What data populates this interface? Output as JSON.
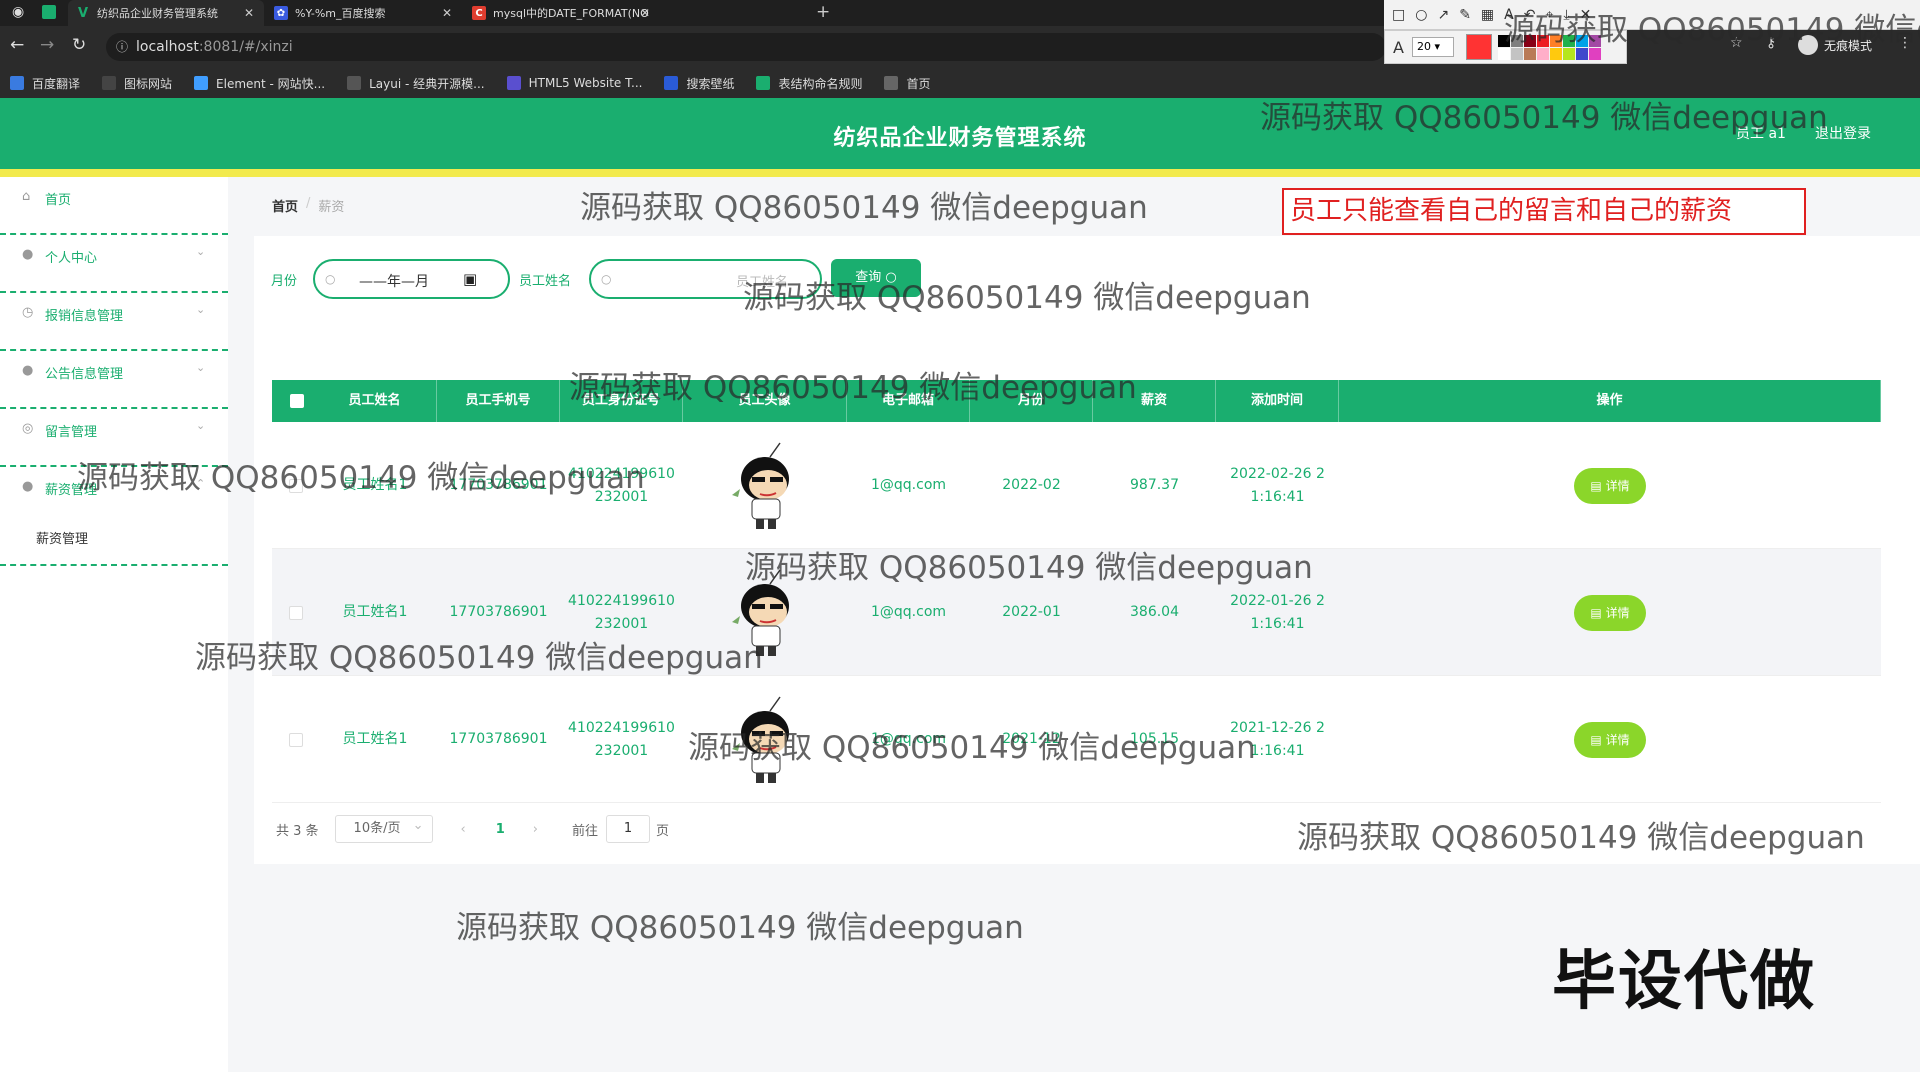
{
  "browser": {
    "tabs": [
      {
        "title": "纺织品企业财务管理系统",
        "icon_text": "V",
        "icon_color": "#1aae6f"
      },
      {
        "title": "%Y-%m_百度搜索",
        "icon_text": "✿",
        "icon_color": "#3a5be0"
      },
      {
        "title": "mysql中的DATE_FORMAT(NO",
        "icon_text": "C",
        "icon_color": "#e03d2f"
      }
    ],
    "url_host": "localhost",
    "url_rest": ":8081/#/xinzi",
    "incognito_label": "无痕模式",
    "bookmarks": [
      {
        "label": "百度翻译",
        "icon_color": "#3a7be0"
      },
      {
        "label": "图标网站",
        "icon_color": "#444"
      },
      {
        "label": "Element - 网站快...",
        "icon_color": "#409eff"
      },
      {
        "label": "Layui - 经典开源模...",
        "icon_color": "#555"
      },
      {
        "label": "HTML5 Website T...",
        "icon_color": "#5a4fcf"
      },
      {
        "label": "搜索壁纸",
        "icon_color": "#2a5bd7"
      },
      {
        "label": "表结构命名规则",
        "icon_color": "#1aae6f"
      },
      {
        "label": "首页",
        "icon_color": "#666"
      }
    ]
  },
  "annotation_tool": {
    "font_size": "20",
    "active_color": "#ff3333"
  },
  "header": {
    "title": "纺织品企业财务管理系统",
    "user": "员工 a1",
    "logout": "退出登录"
  },
  "sidebar": {
    "items": [
      {
        "label": "首页",
        "icon": "home-icon",
        "glyph": "⌂",
        "has_chevron": false
      },
      {
        "label": "个人中心",
        "icon": "user-icon",
        "glyph": "●",
        "has_chevron": true
      },
      {
        "label": "报销信息管理",
        "icon": "clock-icon",
        "glyph": "◷",
        "has_chevron": true
      },
      {
        "label": "公告信息管理",
        "icon": "user-icon",
        "glyph": "●",
        "has_chevron": true
      },
      {
        "label": "留言管理",
        "icon": "globe-icon",
        "glyph": "◎",
        "has_chevron": true
      },
      {
        "label": "薪资管理",
        "icon": "pin-icon",
        "glyph": "●",
        "has_chevron": true
      }
    ],
    "sub_item": "薪资管理"
  },
  "breadcrumb": {
    "home": "首页",
    "separator": "/",
    "current": "薪资"
  },
  "note": "员工只能查看自己的留言和自己的薪资",
  "search": {
    "month_label": "月份",
    "month_value": "——年—月",
    "name_label": "员工姓名",
    "name_placeholder": "员工姓名",
    "query_button": "查询"
  },
  "table": {
    "columns": [
      "员工姓名",
      "员工手机号",
      "员工身份证号",
      "员工头像",
      "电子邮箱",
      "月份",
      "薪资",
      "添加时间",
      "操作"
    ],
    "rows": [
      {
        "name": "员工姓名1",
        "phone": "17703786901",
        "id_card": "410224199610232001",
        "email": "1@qq.com",
        "month": "2022-02",
        "salary": "987.37",
        "added": "2022-02-26 21:16:41",
        "action": "详情"
      },
      {
        "name": "员工姓名1",
        "phone": "17703786901",
        "id_card": "410224199610232001",
        "email": "1@qq.com",
        "month": "2022-01",
        "salary": "386.04",
        "added": "2022-01-26 21:16:41",
        "action": "详情"
      },
      {
        "name": "员工姓名1",
        "phone": "17703786901",
        "id_card": "410224199610232001",
        "email": "1@qq.com",
        "month": "2021-12",
        "salary": "105.15",
        "added": "2021-12-26 21:16:41",
        "action": "详情"
      }
    ]
  },
  "pagination": {
    "total": "共 3 条",
    "page_size": "10条/页",
    "current_page": "1",
    "goto_label": "前往",
    "goto_value": "1",
    "page_unit": "页"
  },
  "overlays": {
    "watermark_text": "源码获取 QQ86050149 微信deepguan",
    "stamp": "毕设代做"
  },
  "colors": {
    "brand_green": "#1aae6f",
    "accent_yellow": "#f2ea4d",
    "detail_button": "#8bd62a",
    "note_red": "#e02020"
  }
}
